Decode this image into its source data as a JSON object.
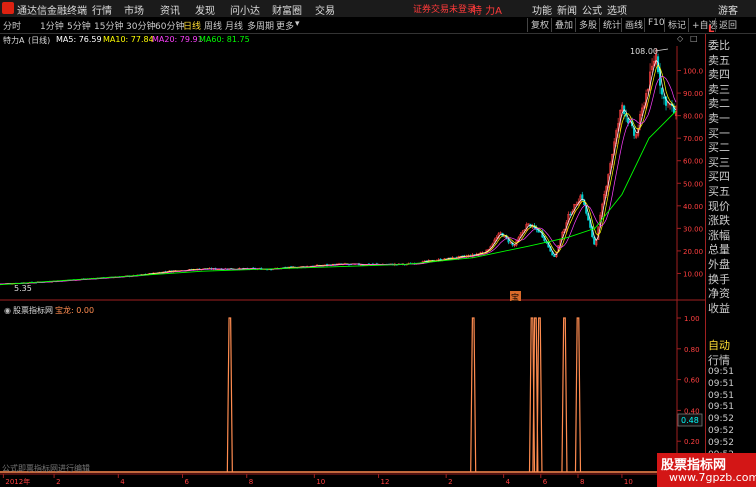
{
  "menubar": {
    "app_name": "通达信金融终端",
    "items": [
      "行情",
      "市场",
      "资讯",
      "发现",
      "问小达",
      "财富圈",
      "交易"
    ],
    "warning": "证券交易未登录",
    "security": "特 力A",
    "right_items": [
      "功能",
      "新闻",
      "公式",
      "选项",
      "游客"
    ]
  },
  "periods": [
    "分时",
    "1分钟",
    "5分钟",
    "15分钟",
    "30分钟",
    "60分钟",
    "日线",
    "周线",
    "月线",
    "多周期",
    "更多"
  ],
  "active_period": "日线",
  "toolbar": [
    "复权",
    "叠加",
    "多股",
    "统计",
    "画线",
    "F10",
    "标记",
    "+自选",
    "返回"
  ],
  "info": {
    "title": "特力A",
    "period_label": "(日线)",
    "ma5": "MA5: 76.59",
    "ma10": "MA10: 77.84",
    "ma20": "MA20: 79.91",
    "ma60": "MA60: 81.75"
  },
  "indicator": {
    "title": "股票指标网",
    "name": "宝龙: 0.00",
    "note": "公式即票指标网进行编辑"
  },
  "price_axis": [
    "100.0",
    "90.00",
    "80.00",
    "70.00",
    "60.00",
    "50.00",
    "40.00",
    "30.00",
    "20.00",
    "10.00"
  ],
  "ind_axis": [
    "1.00",
    "0.80",
    "0.60",
    "0.40",
    "0.20"
  ],
  "ind_marker": "0.48",
  "annotations": {
    "high": "108.00",
    "low": "5.35",
    "flag": "宝"
  },
  "time_axis": [
    "2012年",
    "2",
    "4",
    "6",
    "8",
    "10",
    "12",
    "2",
    "4",
    "6",
    "8",
    "10",
    "11"
  ],
  "right_panel": {
    "header": "L",
    "labels": [
      "委比",
      "卖五",
      "卖四",
      "卖三",
      "卖二",
      "卖一",
      "买一",
      "买二",
      "买三",
      "买四",
      "买五",
      "现价",
      "涨跌",
      "涨幅",
      "总量",
      "外盘",
      "换手",
      "净资",
      "收益"
    ],
    "section": "自动",
    "section2": "行情",
    "times": [
      "09:51",
      "09:51",
      "09:51",
      "09:51",
      "09:52",
      "09:52",
      "09:52",
      "09:52",
      "09:52",
      "09:52"
    ]
  },
  "watermark": {
    "line1": "股票指标网",
    "line2": "www.7gpzb.com"
  },
  "colors": {
    "up": "#ff4040",
    "down": "#00d0d0",
    "ma5": "#ffffff",
    "ma10": "#ffff00",
    "ma20": "#ff40ff",
    "ma60": "#00ff00",
    "signal": "#ff8c50"
  },
  "chart_data": {
    "type": "line",
    "price_ylim": [
      0,
      110
    ],
    "price_x": [
      0,
      0.05,
      0.1,
      0.15,
      0.2,
      0.25,
      0.3,
      0.35,
      0.4,
      0.45,
      0.5,
      0.55,
      0.6,
      0.65,
      0.7,
      0.72,
      0.74,
      0.76,
      0.78,
      0.8,
      0.82,
      0.84,
      0.86,
      0.88,
      0.9,
      0.92,
      0.94,
      0.96,
      0.97,
      0.98,
      0.99,
      1.0
    ],
    "price_close": [
      5.35,
      6,
      7,
      8,
      9,
      11,
      12,
      12,
      12,
      13,
      14,
      14,
      14,
      16,
      18,
      20,
      28,
      22,
      32,
      28,
      17,
      35,
      45,
      22,
      55,
      85,
      70,
      95,
      108,
      88,
      85,
      80
    ],
    "ma60_x": [
      0,
      0.3,
      0.6,
      0.7,
      0.78,
      0.84,
      0.88,
      0.92,
      0.96,
      1.0
    ],
    "ma60": [
      5,
      11,
      14,
      17,
      22,
      26,
      30,
      45,
      70,
      82
    ],
    "signal_x": [
      0.34,
      0.7,
      0.787,
      0.792,
      0.798,
      0.835,
      0.855
    ],
    "signal_values": [
      1,
      1,
      1,
      1,
      1,
      1,
      1
    ],
    "ind_ylim": [
      0,
      1
    ]
  }
}
